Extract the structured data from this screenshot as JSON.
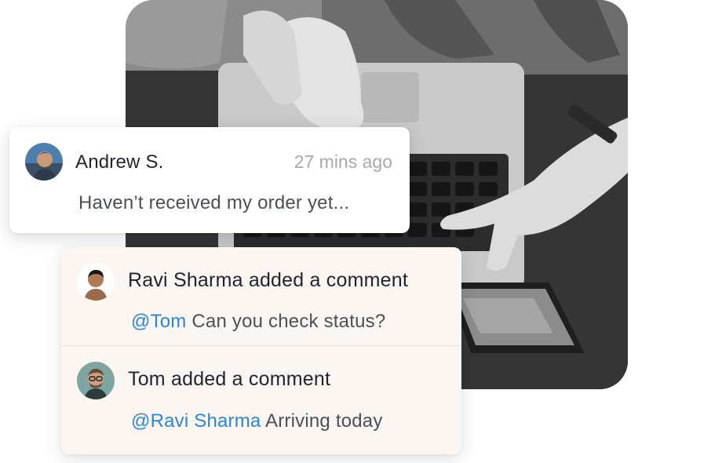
{
  "colors": {
    "mention": "#2b86d9",
    "text_primary": "#1f2430",
    "text_secondary": "#4a5059",
    "timestamp": "#a4a8b0",
    "comment_panel_bg": "#fbf6f1"
  },
  "notification": {
    "author": "Andrew S.",
    "timestamp": "27 mins ago",
    "message": "Haven’t received my order yet...",
    "avatar_icon": "avatar-andrew"
  },
  "comments": [
    {
      "author": "Ravi Sharma",
      "action": " added a comment",
      "mention": "@Tom",
      "text": " Can you check status?",
      "avatar_icon": "avatar-ravi"
    },
    {
      "author": "Tom",
      "action": " added a comment",
      "mention": "@Ravi Sharma",
      "text": " Arriving today",
      "avatar_icon": "avatar-tom"
    }
  ]
}
